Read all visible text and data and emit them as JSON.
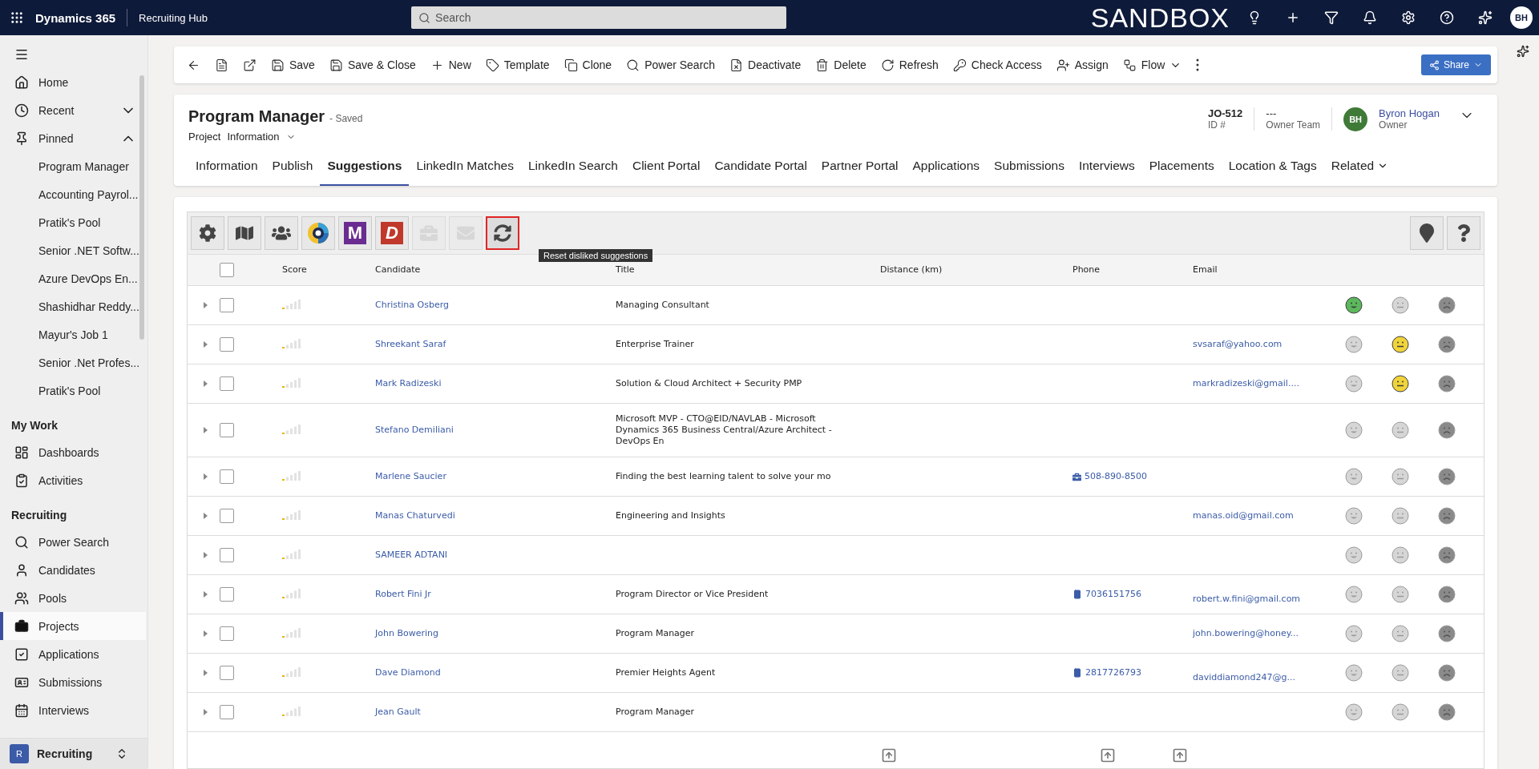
{
  "topbar": {
    "app": "Dynamics 365",
    "area": "Recruiting Hub",
    "search": {
      "placeholder": "Search"
    },
    "environment": "SANDBOX",
    "avatar": "BH"
  },
  "sidebar": {
    "items": [
      {
        "kind": "item",
        "label": "Home",
        "selected": false
      },
      {
        "kind": "group",
        "label": "Recent",
        "expanded": false
      },
      {
        "kind": "group",
        "label": "Pinned",
        "expanded": true,
        "children": [
          {
            "label": "Program Manager"
          },
          {
            "label": "Accounting Payrol..."
          },
          {
            "label": "Pratik's Pool"
          },
          {
            "label": "Senior .NET Softw..."
          },
          {
            "label": "Azure DevOps En..."
          },
          {
            "label": "Shashidhar Reddy..."
          },
          {
            "label": "Mayur's Job 1"
          },
          {
            "label": "Senior .Net Profes..."
          },
          {
            "label": "Pratik's Pool"
          }
        ]
      },
      {
        "kind": "section",
        "label": "My Work"
      },
      {
        "kind": "item",
        "label": "Dashboards",
        "selected": false
      },
      {
        "kind": "item",
        "label": "Activities",
        "selected": false
      },
      {
        "kind": "section",
        "label": "Recruiting"
      },
      {
        "kind": "item",
        "label": "Power Search",
        "selected": false
      },
      {
        "kind": "item",
        "label": "Candidates",
        "selected": false
      },
      {
        "kind": "item",
        "label": "Pools",
        "selected": false
      },
      {
        "kind": "item",
        "label": "Projects",
        "selected": true
      },
      {
        "kind": "item",
        "label": "Applications",
        "selected": false
      },
      {
        "kind": "item",
        "label": "Submissions",
        "selected": false
      },
      {
        "kind": "item",
        "label": "Interviews",
        "selected": false
      }
    ],
    "area_switcher": {
      "badge": "R",
      "label": "Recruiting"
    }
  },
  "commands": [
    {
      "kind": "icon"
    },
    {
      "kind": "icon"
    },
    {
      "kind": "icon"
    },
    {
      "kind": "button",
      "label": "Save"
    },
    {
      "kind": "button",
      "label": "Save & Close"
    },
    {
      "kind": "button",
      "label": "New"
    },
    {
      "kind": "button",
      "label": "Template"
    },
    {
      "kind": "button",
      "label": "Clone"
    },
    {
      "kind": "button",
      "label": "Power Search"
    },
    {
      "kind": "button",
      "label": "Deactivate"
    },
    {
      "kind": "button",
      "label": "Delete"
    },
    {
      "kind": "button",
      "label": "Refresh"
    },
    {
      "kind": "button",
      "label": "Check Access"
    },
    {
      "kind": "button",
      "label": "Assign"
    },
    {
      "kind": "menu",
      "label": "Flow"
    },
    {
      "kind": "icon"
    }
  ],
  "share": {
    "label": "Share"
  },
  "record": {
    "title": "Program Manager",
    "status": "- Saved",
    "entity": "Project",
    "form": "Information",
    "id": "JO-512",
    "id_label": "ID #",
    "team": "---",
    "team_label": "Owner Team",
    "owner_initials": "BH",
    "owner": "Byron Hogan",
    "owner_label": "Owner"
  },
  "tabs": [
    {
      "label": "Information",
      "selected": false
    },
    {
      "label": "Publish",
      "selected": false
    },
    {
      "label": "Suggestions",
      "selected": true
    },
    {
      "label": "LinkedIn Matches",
      "selected": false
    },
    {
      "label": "LinkedIn Search",
      "selected": false
    },
    {
      "label": "Client Portal",
      "selected": false
    },
    {
      "label": "Candidate Portal",
      "selected": false
    },
    {
      "label": "Partner Portal",
      "selected": false
    },
    {
      "label": "Applications",
      "selected": false
    },
    {
      "label": "Submissions",
      "selected": false
    },
    {
      "label": "Interviews",
      "selected": false
    },
    {
      "label": "Placements",
      "selected": false
    },
    {
      "label": "Location & Tags",
      "selected": false
    },
    {
      "label": "Related",
      "selected": false
    }
  ],
  "toolbar": {
    "buttons": [
      {
        "kind": "settings",
        "disabled": false,
        "highlighted": false
      },
      {
        "kind": "map",
        "disabled": false,
        "highlighted": false
      },
      {
        "kind": "people",
        "disabled": false,
        "highlighted": false
      },
      {
        "kind": "logo",
        "disabled": false,
        "highlighted": false
      },
      {
        "kind": "letter",
        "label": "M",
        "color": "#6b2c91",
        "disabled": false,
        "highlighted": false
      },
      {
        "kind": "letter",
        "label": "D",
        "color": "#c0392b",
        "disabled": false,
        "highlighted": false
      },
      {
        "kind": "briefcase",
        "disabled": true,
        "highlighted": false
      },
      {
        "kind": "mail",
        "disabled": true,
        "highlighted": false
      },
      {
        "kind": "reset",
        "disabled": false,
        "highlighted": true
      }
    ],
    "tooltip": "Reset disliked suggestions",
    "right_buttons": [
      {
        "kind": "pin"
      },
      {
        "kind": "help"
      }
    ]
  },
  "table": {
    "select_all": {
      "checked": false
    },
    "columns": [
      "Score",
      "Candidate",
      "Title",
      "Distance (km)",
      "Phone",
      "Email"
    ],
    "rows": [
      {
        "checked": false,
        "candidate": "Christina Osberg",
        "title": "Managing Consultant",
        "faces": [
          {
            "selected": true
          },
          {
            "selected": false
          },
          {
            "selected": false
          }
        ]
      },
      {
        "checked": false,
        "candidate": "Shreekant Saraf",
        "title": "Enterprise Trainer",
        "email": "svsaraf@yahoo.com",
        "faces": [
          {
            "selected": false
          },
          {
            "selected": true
          },
          {
            "selected": false
          }
        ]
      },
      {
        "checked": false,
        "candidate": "Mark Radizeski",
        "title": "Solution & Cloud Architect + Security PMP",
        "email": "markradizeski@gmail....",
        "faces": [
          {
            "selected": false
          },
          {
            "selected": true
          },
          {
            "selected": false
          }
        ]
      },
      {
        "checked": false,
        "candidate": "Stefano Demiliani",
        "title": "Microsoft MVP - CTO@EID/NAVLAB - Microsoft Dynamics 365 Business Central/Azure Architect - DevOps En",
        "faces": [
          {
            "selected": false
          },
          {
            "selected": false
          },
          {
            "selected": false
          }
        ]
      },
      {
        "checked": false,
        "candidate": "Marlene Saucier",
        "title": "Finding the best learning talent to solve your mo",
        "phone": {
          "kind": "work",
          "number": "508-890-8500"
        },
        "faces": [
          {
            "selected": false
          },
          {
            "selected": false
          },
          {
            "selected": false
          }
        ]
      },
      {
        "checked": false,
        "candidate": "Manas Chaturvedi",
        "title": "Engineering and Insights",
        "email": "manas.oid@gmail.com",
        "faces": [
          {
            "selected": false
          },
          {
            "selected": false
          },
          {
            "selected": false
          }
        ]
      },
      {
        "checked": false,
        "candidate": "SAMEER ADTANI",
        "faces": [
          {
            "selected": false
          },
          {
            "selected": false
          },
          {
            "selected": false
          }
        ]
      },
      {
        "checked": false,
        "candidate": "Robert Fini Jr",
        "title": "Program Director or Vice President",
        "phone": {
          "kind": "mobile",
          "number": "7036151756"
        },
        "email": "robert.w.fini@gmail.com",
        "faces": [
          {
            "selected": false
          },
          {
            "selected": false
          },
          {
            "selected": false
          }
        ]
      },
      {
        "checked": false,
        "candidate": "John Bowering",
        "title": "Program Manager",
        "email": "john.bowering@honey...",
        "faces": [
          {
            "selected": false
          },
          {
            "selected": false
          },
          {
            "selected": false
          }
        ]
      },
      {
        "checked": false,
        "candidate": "Dave Diamond",
        "title": "Premier Heights Agent",
        "phone": {
          "kind": "mobile",
          "number": "2817726793"
        },
        "email": "daviddiamond247@g...",
        "faces": [
          {
            "selected": false
          },
          {
            "selected": false
          },
          {
            "selected": false
          }
        ]
      },
      {
        "checked": false,
        "candidate": "Jean Gault",
        "title": "Program Manager",
        "faces": [
          {
            "selected": false
          },
          {
            "selected": false
          },
          {
            "selected": false
          }
        ]
      }
    ]
  }
}
